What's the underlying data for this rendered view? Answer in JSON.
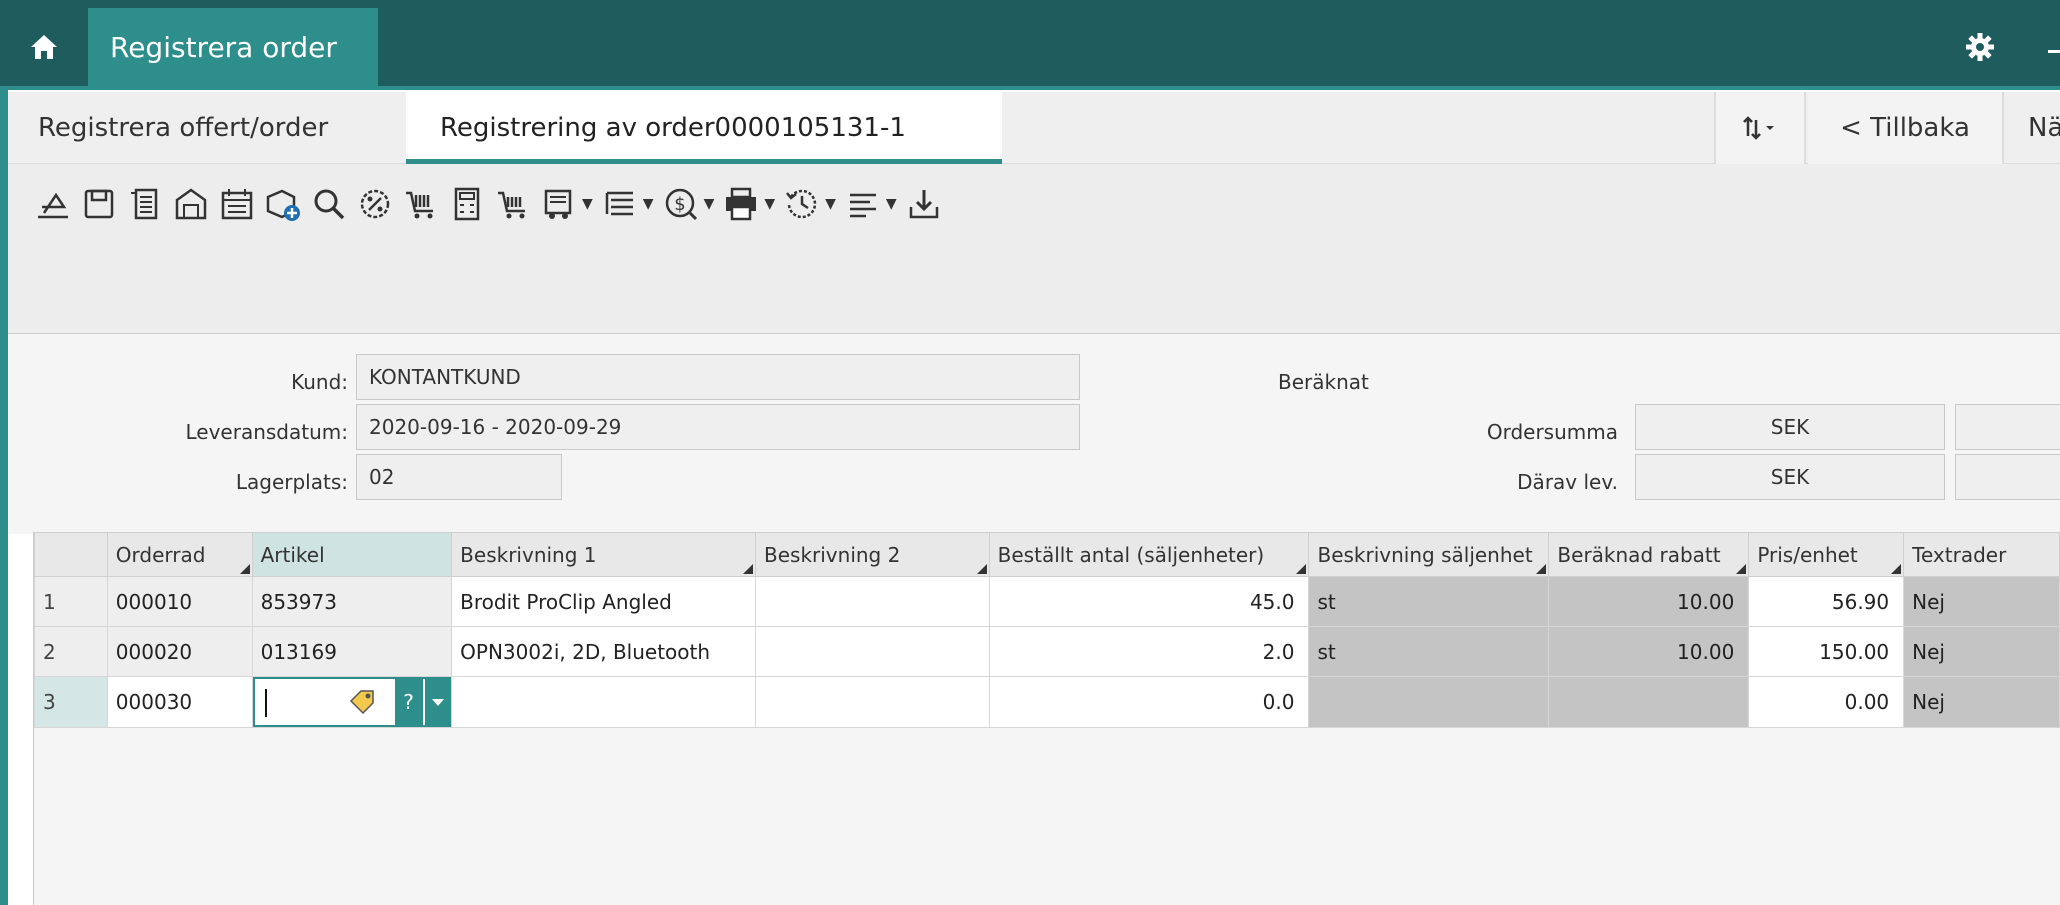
{
  "app": {
    "title": "Registrera order"
  },
  "tabs": [
    {
      "label": "Registrera offert/order"
    },
    {
      "label": "Registrering av order0000105131-1"
    }
  ],
  "nav": {
    "back_label": "< Tillbaka",
    "next_label": "Nästa"
  },
  "toolbar": {
    "icons": [
      "new-icon",
      "save-icon",
      "document-icon",
      "warehouse-icon",
      "calendar-icon",
      "add-package-icon",
      "search-icon",
      "discount-icon",
      "cart-icon",
      "calculator-icon",
      "cart-list-icon",
      "truck-icon",
      "list-icon",
      "money-icon",
      "printer-icon",
      "history-icon",
      "text-align-icon",
      "download-icon"
    ]
  },
  "form": {
    "kund_label": "Kund:",
    "kund_value": "KONTANTKUND",
    "leveransdatum_label": "Leveransdatum:",
    "leveransdatum_value": "2020-09-16 - 2020-09-29",
    "lagerplats_label": "Lagerplats:",
    "lagerplats_value": "02",
    "beraknat_label": "Beräknat",
    "ordersumma_label": "Ordersumma",
    "ordersumma_currency": "SEK",
    "darav_label": "Därav lev.",
    "darav_currency": "SEK"
  },
  "grid": {
    "columns": [
      "Orderrad",
      "Artikel",
      "Beskrivning 1",
      "Beskrivning 2",
      "Beställt antal  (säljenheter)",
      "Beskrivning säljenhet",
      "Beräknad rabatt",
      "Pris/enhet",
      "Textrader"
    ],
    "rows": [
      {
        "n": "1",
        "orderrad": "000010",
        "artikel": "853973",
        "besk1": "Brodit ProClip Angled",
        "besk2": "",
        "antal": "45.0",
        "enhet": "st",
        "rabatt": "10.00",
        "pris": "56.90",
        "text": "Nej"
      },
      {
        "n": "2",
        "orderrad": "000020",
        "artikel": "013169",
        "besk1": "OPN3002i, 2D, Bluetooth",
        "besk2": "",
        "antal": "2.0",
        "enhet": "st",
        "rabatt": "10.00",
        "pris": "150.00",
        "text": "Nej"
      },
      {
        "n": "3",
        "orderrad": "000030",
        "artikel": "",
        "besk1": "",
        "besk2": "",
        "antal": "0.0",
        "enhet": "",
        "rabatt": "",
        "pris": "0.00",
        "text": "Nej"
      }
    ],
    "artikel_help": "?"
  },
  "colors": {
    "topbar": "#1f5c5e",
    "accent": "#2d8e8c"
  }
}
